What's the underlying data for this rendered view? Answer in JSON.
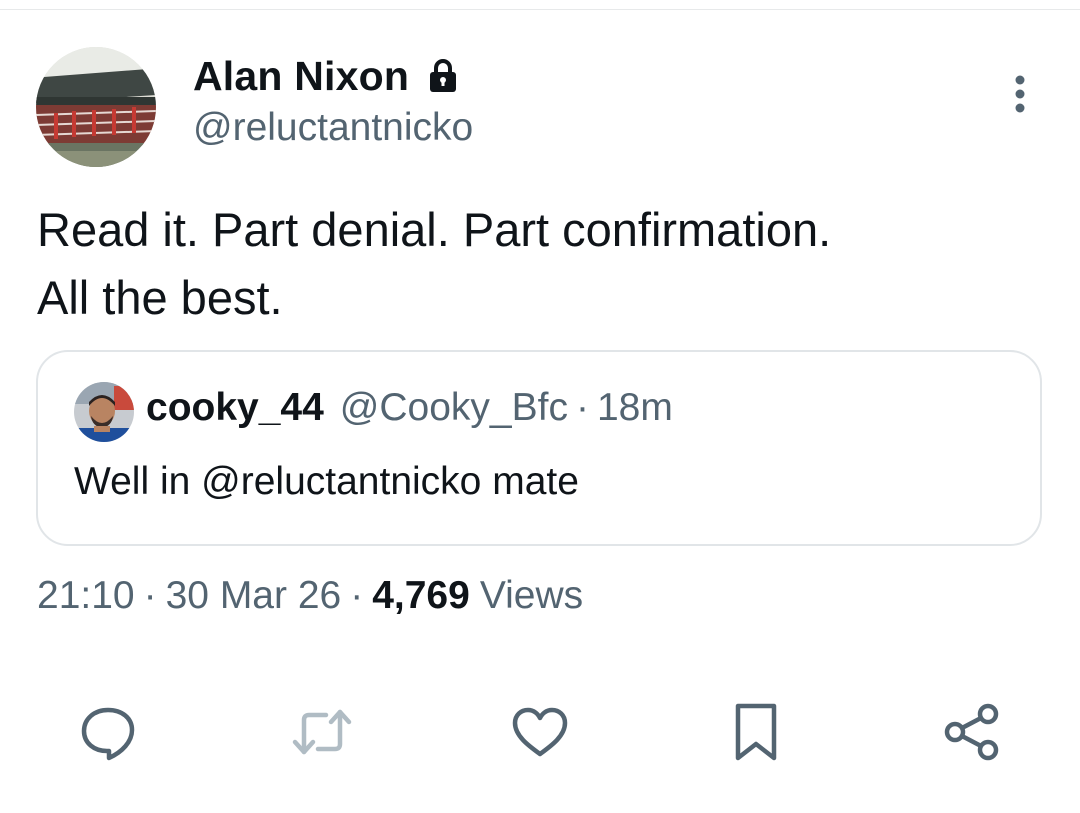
{
  "tweet": {
    "author": {
      "name": "Alan Nixon",
      "handle": "@reluctantnicko",
      "protected_icon": "lock-icon",
      "avatar_icon": "stadium-stand-photo"
    },
    "text_line_1": "Read it. Part denial. Part confirmation.",
    "text_line_2": "All the best.",
    "quoted": {
      "name": "cooky_44",
      "handle": "@Cooky_Bfc",
      "separator": "·",
      "time": "18m",
      "text": "Well in @reluctantnicko mate",
      "avatar_icon": "profile-photo"
    },
    "meta": {
      "time": "21:10",
      "separator": "·",
      "date": "30 Mar 26",
      "views_count": "4,769",
      "views_label": "Views"
    },
    "actions": [
      {
        "name": "reply",
        "icon": "reply-icon"
      },
      {
        "name": "retweet",
        "icon": "retweet-icon"
      },
      {
        "name": "like",
        "icon": "heart-icon"
      },
      {
        "name": "bookmark",
        "icon": "bookmark-icon"
      },
      {
        "name": "share",
        "icon": "share-icon"
      }
    ]
  },
  "colors": {
    "text_primary": "#0f1419",
    "text_secondary": "#536471",
    "retweet_icon": "#b0bcc4",
    "border": "#e1e5e8"
  }
}
